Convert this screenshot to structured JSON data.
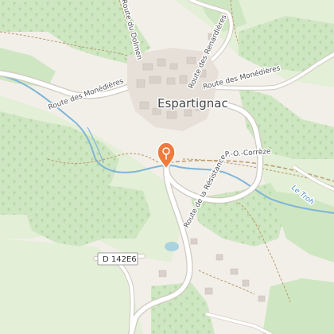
{
  "map": {
    "place_name": "Espartignac",
    "colors": {
      "background": "#f2efe9",
      "forest": "#cfe6c2",
      "meadow": "#e3efd6",
      "water": "#aad3df",
      "river_line": "#7fb5d6",
      "road": "#ffffff",
      "road_casing": "#cfcac2",
      "building": "#d9d0c9",
      "path": "#b99a6b",
      "marker": "#f07a3c"
    },
    "roads": [
      {
        "id": "r1",
        "label": "Route des Monédières"
      },
      {
        "id": "r2",
        "label": "Route des Monédières"
      },
      {
        "id": "r3",
        "label": "Route des Renardières"
      },
      {
        "id": "r4",
        "label": "Route de la Résistance"
      },
      {
        "id": "r5",
        "label": "Route du Dolmen"
      },
      {
        "id": "r6",
        "label": "P.-O.-Corrèze"
      }
    ],
    "river": {
      "label": "Le Troh"
    },
    "shield": {
      "label": "D 142E6"
    },
    "marker": {
      "icon": "map-pin-icon"
    }
  }
}
